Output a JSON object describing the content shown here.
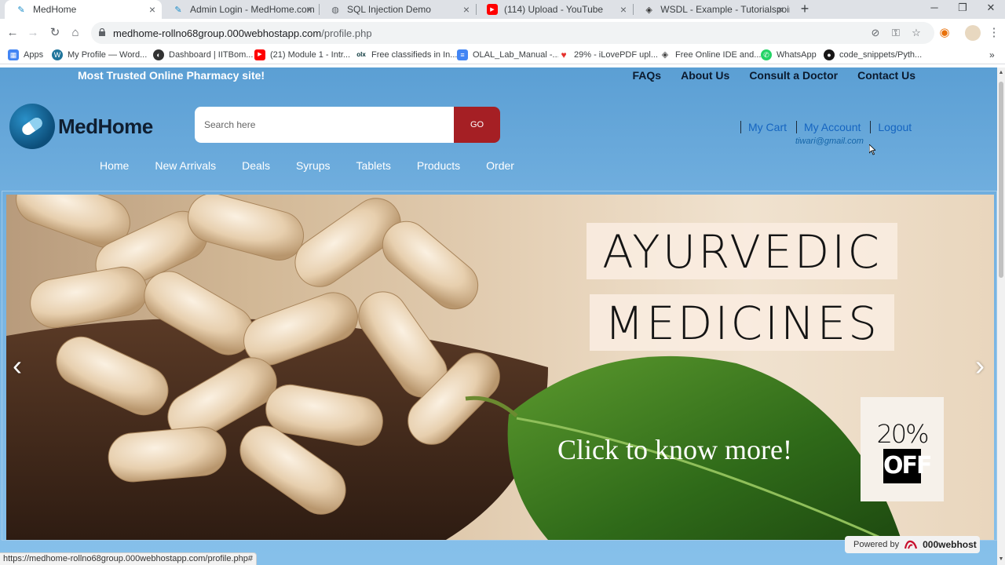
{
  "browser": {
    "tabs": [
      {
        "title": "MedHome",
        "icon": "medhome-favicon",
        "active": true
      },
      {
        "title": "Admin Login - MedHome.com",
        "icon": "medhome-favicon"
      },
      {
        "title": "SQL Injection Demo",
        "icon": "globe-icon"
      },
      {
        "title": "(114) Upload - YouTube",
        "icon": "youtube-icon"
      },
      {
        "title": "WSDL - Example - Tutorialspoint",
        "icon": "tutorialspoint-icon"
      }
    ],
    "url_host": "medhome-rollno68group.000webhostapp.com",
    "url_path": "/profile.php",
    "bookmarks": [
      {
        "label": "Apps",
        "icon": "apps-icon",
        "color": "#4285f4"
      },
      {
        "label": "My Profile — Word...",
        "icon": "wordpress-icon",
        "color": "#21759b"
      },
      {
        "label": "Dashboard | IITBom...",
        "icon": "dashboard-icon",
        "color": "#333333"
      },
      {
        "label": "(21) Module 1 - Intr...",
        "icon": "youtube-icon",
        "color": "#ff0000"
      },
      {
        "label": "Free classifieds in In...",
        "icon": "olx-icon",
        "color": "#002f34"
      },
      {
        "label": "OLAL_Lab_Manual -...",
        "icon": "docs-icon",
        "color": "#4285f4"
      },
      {
        "label": "29% - iLovePDF upl...",
        "icon": "ilovepdf-icon",
        "color": "#e5322d"
      },
      {
        "label": "Free Online IDE and...",
        "icon": "ide-icon",
        "color": "#444444"
      },
      {
        "label": "WhatsApp",
        "icon": "whatsapp-icon",
        "color": "#25d366"
      },
      {
        "label": "code_snippets/Pyth...",
        "icon": "github-icon",
        "color": "#181717"
      }
    ],
    "status_url": "https://medhome-rollno68group.000webhostapp.com/profile.php#"
  },
  "site": {
    "tagline": "Most Trusted Online Pharmacy site!",
    "top_links": [
      "FAQs",
      "About Us",
      "Consult a Doctor",
      "Contact Us"
    ],
    "logo_text": "MedHome",
    "search": {
      "placeholder": "Search here",
      "button": "GO"
    },
    "account": {
      "cart": "My Cart",
      "account": "My Account",
      "logout": "Logout",
      "email": "tiwari@gmail.com"
    },
    "nav": [
      "Home",
      "New Arrivals",
      "Deals",
      "Syrups",
      "Tablets",
      "Products",
      "Order"
    ]
  },
  "banner": {
    "line1": "AYURVEDIC",
    "line2": "MEDICINES",
    "cta": "Click to know more!",
    "offer_pct": "20%",
    "offer_word": "OFF",
    "prev": "‹",
    "next": "›"
  },
  "powered_by": {
    "label": "Powered by",
    "brand": "000webhost"
  },
  "colors": {
    "accent": "#a51f24",
    "link": "#1565c0",
    "header_bg": "#74b1e0"
  }
}
